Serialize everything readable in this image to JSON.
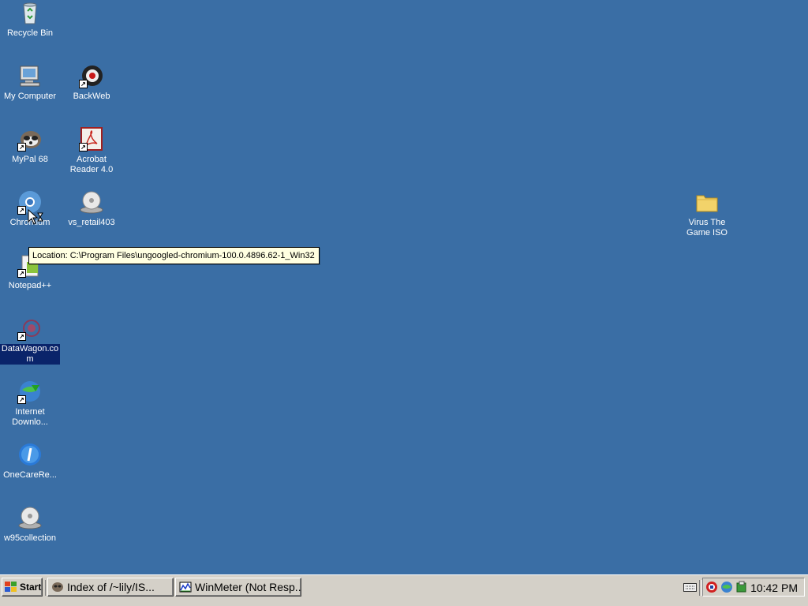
{
  "desktop": {
    "background": "#3a6ea5",
    "icons": [
      {
        "name": "recycle-bin",
        "label": "Recycle Bin"
      },
      {
        "name": "my-computer",
        "label": "My Computer"
      },
      {
        "name": "backweb",
        "label": "BackWeb"
      },
      {
        "name": "mypal-68",
        "label": "MyPal 68"
      },
      {
        "name": "acrobat-reader",
        "label": "Acrobat Reader 4.0"
      },
      {
        "name": "chromium",
        "label": "Chromium"
      },
      {
        "name": "vs-retail403",
        "label": "vs_retail403"
      },
      {
        "name": "notepad-plus-plus",
        "label": "Notepad++"
      },
      {
        "name": "datawagon",
        "label": "DataWagon.com"
      },
      {
        "name": "internet-download",
        "label": "Internet Downlo..."
      },
      {
        "name": "onecare",
        "label": "OneCareRe..."
      },
      {
        "name": "w95collection",
        "label": "w95collection"
      },
      {
        "name": "virus-the-game",
        "label": "Virus The Game ISO"
      }
    ],
    "tooltip": "Location: C:\\Program Files\\ungoogled-chromium-100.0.4896.62-1_Win32"
  },
  "taskbar": {
    "start_label": "Start",
    "tasks": [
      {
        "label": "Index of /~lily/IS..."
      },
      {
        "label": "WinMeter (Not Resp..."
      }
    ],
    "clock": "10:42 PM"
  }
}
